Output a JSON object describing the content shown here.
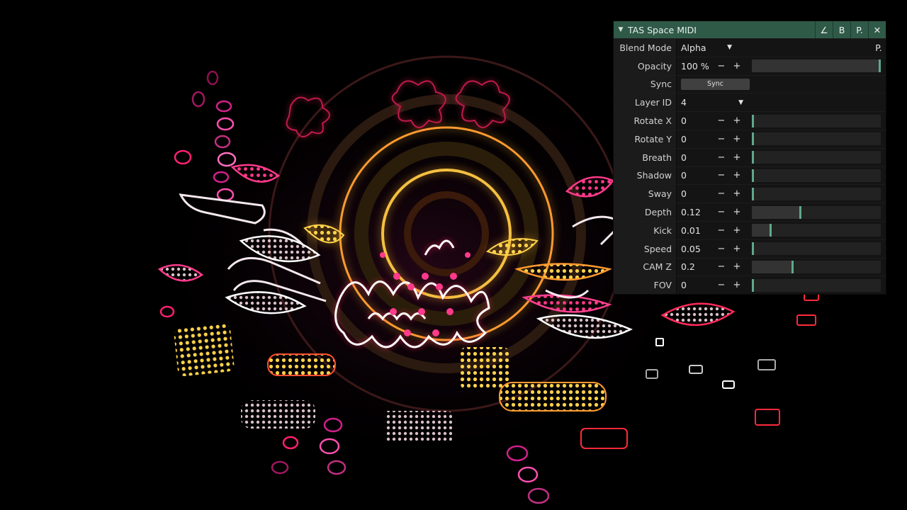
{
  "panel": {
    "title": "TAS Space MIDI",
    "collapse_icon": "triangle-down-icon",
    "buttons": {
      "angle": "∠",
      "bypass": "B",
      "preset": "P.",
      "close": "✕"
    },
    "accent_color": "#2f5a48",
    "handle_color": "#5fa98a",
    "blend_mode": {
      "label": "Blend Mode",
      "value": "Alpha",
      "p_button": "P."
    },
    "opacity": {
      "label": "Opacity",
      "value": "100 %",
      "minus": "−",
      "plus": "+",
      "level": 1.0
    },
    "sync": {
      "label": "Sync",
      "button": "Sync"
    },
    "layer_id": {
      "label": "Layer ID",
      "value": "4"
    },
    "params": [
      {
        "label": "Rotate X",
        "value": "0",
        "minus": "−",
        "plus": "+",
        "level": 0.0
      },
      {
        "label": "Rotate Y",
        "value": "0",
        "minus": "−",
        "plus": "+",
        "level": 0.0
      },
      {
        "label": "Breath",
        "value": "0",
        "minus": "−",
        "plus": "+",
        "level": 0.0
      },
      {
        "label": "Shadow",
        "value": "0",
        "minus": "−",
        "plus": "+",
        "level": 0.0
      },
      {
        "label": "Sway",
        "value": "0",
        "minus": "−",
        "plus": "+",
        "level": 0.0
      },
      {
        "label": "Depth",
        "value": "0.12",
        "minus": "−",
        "plus": "+",
        "level": 0.37
      },
      {
        "label": "Kick",
        "value": "0.01",
        "minus": "−",
        "plus": "+",
        "level": 0.14
      },
      {
        "label": "Speed",
        "value": "0.05",
        "minus": "−",
        "plus": "+",
        "level": 0.0
      },
      {
        "label": "CAM Z",
        "value": "0.2",
        "minus": "−",
        "plus": "+",
        "level": 0.31
      },
      {
        "label": "FOV",
        "value": "0",
        "minus": "−",
        "plus": "+",
        "level": 0.0
      }
    ]
  },
  "artwork": {
    "name": "psychedelic-visual"
  }
}
